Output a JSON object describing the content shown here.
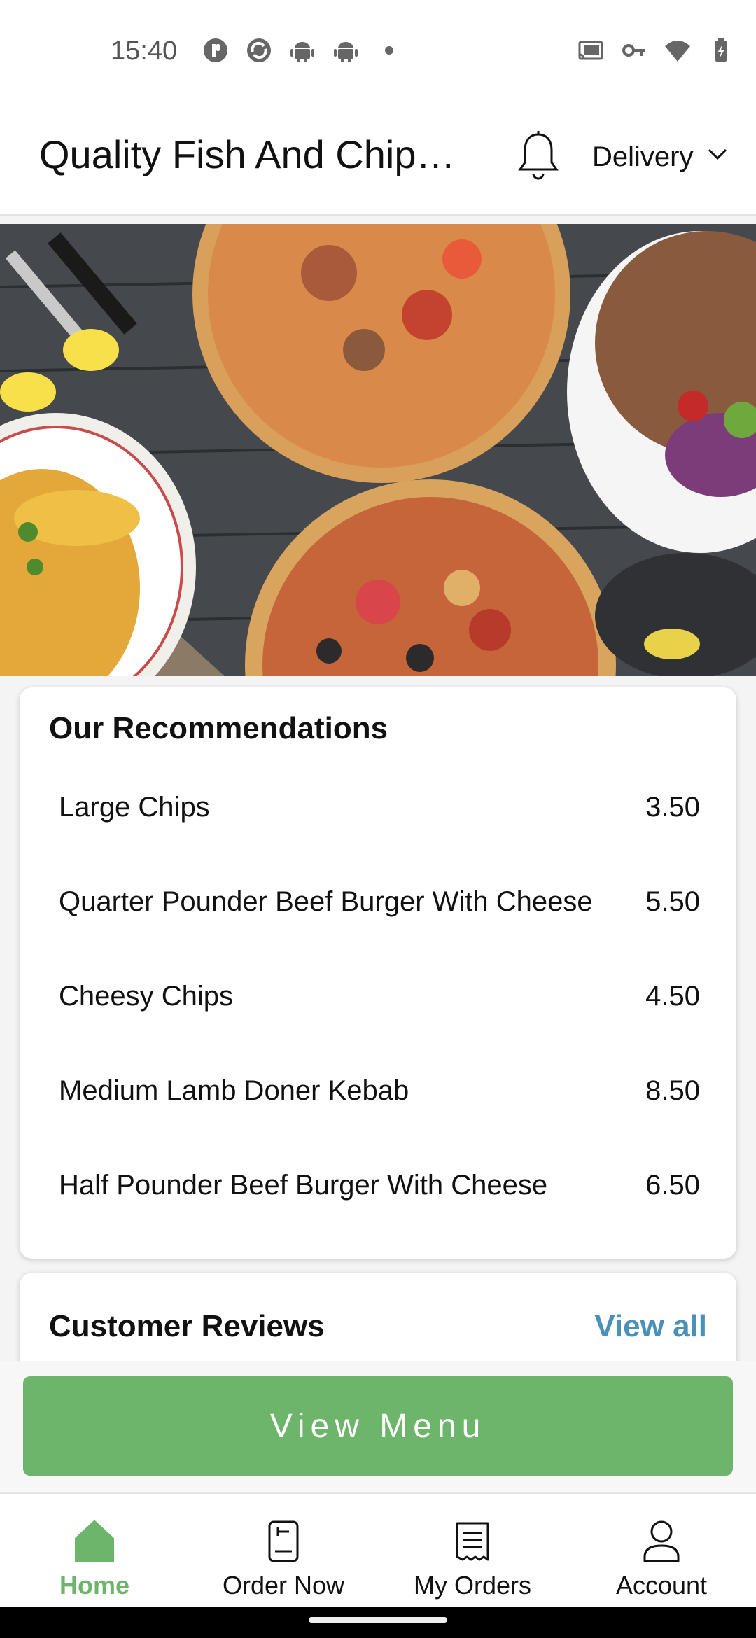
{
  "status_bar": {
    "time": "15:40",
    "left_icons": [
      "app-notification-icon",
      "sync-icon",
      "android-icon",
      "android-icon",
      "dot-icon"
    ],
    "right_icons": [
      "cast-icon",
      "key-icon",
      "wifi-icon",
      "battery-charging-icon"
    ]
  },
  "header": {
    "title": "Quality Fish And Chip…",
    "bell_icon": "bell-icon",
    "mode_label": "Delivery",
    "mode_icon": "chevron-down-icon"
  },
  "recommendations": {
    "title": "Our Recommendations",
    "items": [
      {
        "name": "Large Chips",
        "price": "3.50"
      },
      {
        "name": "Quarter Pounder Beef Burger With Cheese",
        "price": "5.50"
      },
      {
        "name": "Cheesy Chips",
        "price": "4.50"
      },
      {
        "name": "Medium Lamb Doner Kebab",
        "price": "8.50"
      },
      {
        "name": "Half Pounder Beef Burger With Cheese",
        "price": "6.50"
      }
    ]
  },
  "reviews": {
    "title": "Customer Reviews",
    "view_all": "View all"
  },
  "view_menu_label": "View Menu",
  "nav": [
    {
      "label": "Home",
      "icon": "home-icon",
      "active": true
    },
    {
      "label": "Order Now",
      "icon": "order-icon",
      "active": false
    },
    {
      "label": "My Orders",
      "icon": "receipt-icon",
      "active": false
    },
    {
      "label": "Account",
      "icon": "person-icon",
      "active": false
    }
  ],
  "colors": {
    "accent_green": "#6db56a",
    "link_blue": "#4a90b8"
  }
}
